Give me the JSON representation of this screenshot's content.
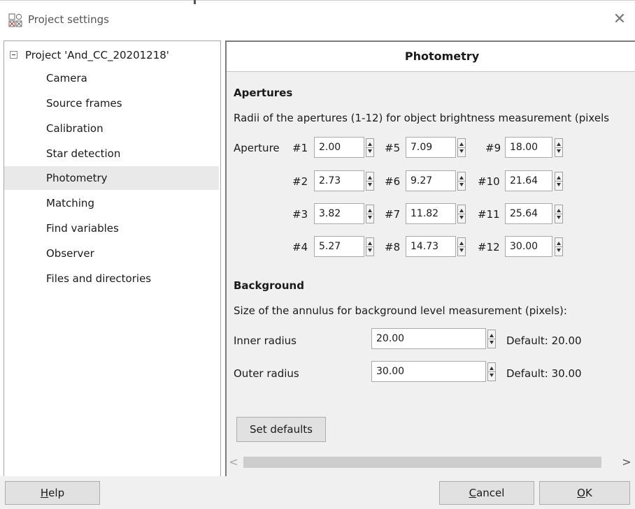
{
  "window": {
    "title": "Project settings",
    "close_glyph": "✕"
  },
  "tree": {
    "root_label": "Project 'And_CC_20201218'",
    "items": [
      {
        "label": "Camera"
      },
      {
        "label": "Source frames"
      },
      {
        "label": "Calibration"
      },
      {
        "label": "Star detection"
      },
      {
        "label": "Photometry"
      },
      {
        "label": "Matching"
      },
      {
        "label": "Find variables"
      },
      {
        "label": "Observer"
      },
      {
        "label": "Files and directories"
      }
    ],
    "selected": "Photometry"
  },
  "panel": {
    "title": "Photometry",
    "apertures": {
      "heading": "Apertures",
      "description": "Radii of the apertures (1-12) for object brightness measurement (pixels",
      "row_label": "Aperture",
      "items": [
        {
          "label": "#1",
          "value": "2.00"
        },
        {
          "label": "#2",
          "value": "2.73"
        },
        {
          "label": "#3",
          "value": "3.82"
        },
        {
          "label": "#4",
          "value": "5.27"
        },
        {
          "label": "#5",
          "value": "7.09"
        },
        {
          "label": "#6",
          "value": "9.27"
        },
        {
          "label": "#7",
          "value": "11.82"
        },
        {
          "label": "#8",
          "value": "14.73"
        },
        {
          "label": "#9",
          "value": "18.00"
        },
        {
          "label": "#10",
          "value": "21.64"
        },
        {
          "label": "#11",
          "value": "25.64"
        },
        {
          "label": "#12",
          "value": "30.00"
        }
      ]
    },
    "background": {
      "heading": "Background",
      "description": "Size of the annulus for background level measurement (pixels):",
      "inner": {
        "label": "Inner radius",
        "value": "20.00",
        "default": "Default: 20.00"
      },
      "outer": {
        "label": "Outer radius",
        "value": "30.00",
        "default": "Default: 30.00"
      }
    },
    "set_defaults_label": "Set defaults"
  },
  "scrollbar": {
    "left_glyph": "<",
    "right_glyph": ">"
  },
  "footer": {
    "help": {
      "mnemonic": "H",
      "rest": "elp"
    },
    "cancel": {
      "mnemonic": "C",
      "rest": "ancel"
    },
    "ok": {
      "mnemonic": "O",
      "rest": "K"
    }
  }
}
